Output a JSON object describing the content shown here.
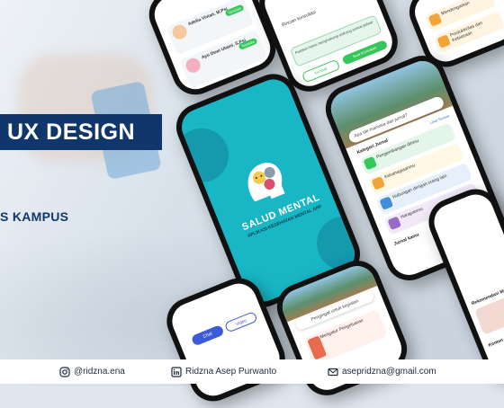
{
  "banner": {
    "title": "UX DESIGN",
    "subtitle": "S KAMPUS"
  },
  "splash": {
    "app_name": "SALUD MENTAL",
    "tagline": "APLIKASI KESEHATAN MENTAL APP"
  },
  "top_left_screen": {
    "doctors": [
      {
        "name": "Adelia Vivian, M.Psi",
        "status": "Tersedia"
      },
      {
        "name": "Ayu Dewi Utami, S.Psi",
        "status": "Tersedia"
      }
    ]
  },
  "top_mid_screen": {
    "info": "Rincian konsultasi",
    "note": "Pastikan kamu menghubungi psikolog sesuai jadwal",
    "back": "Kembali",
    "confirm": "Buat Konsultasi"
  },
  "top_right_screen": {
    "items": [
      "Mendengarkan",
      "Produktivitas dan Kebiasaan"
    ]
  },
  "right_screen": {
    "greeting": "Apa ide manusia dari jurnal?",
    "section_title": "Kategori Jurnal",
    "see_all": "Lihat Semua",
    "categories": [
      "Pengembangan dirimu",
      "Kebahagiaanmu",
      "Hubungan dengan orang lain",
      "Harapanmu"
    ],
    "journal_title": "Jurnal kamu"
  },
  "far_right_screen": {
    "recommend_title": "Rekomendasi Meditasi",
    "content_title": "Konten Salud"
  },
  "bot_left_screen": {
    "tab_chat": "Chat",
    "tab_video": "Video"
  },
  "bot_mid_screen": {
    "header": "Pengingat untuk kegiatan",
    "item": "Mengatur Pengeluaran"
  },
  "footer": {
    "instagram": "@ridzna.ena",
    "linkedin": "Ridzna Asep Purwanto",
    "email": "asepridzna@gmail.com"
  }
}
